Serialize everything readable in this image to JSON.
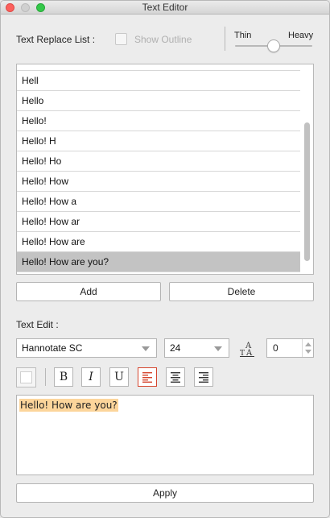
{
  "window": {
    "title": "Text Editor"
  },
  "replace": {
    "label": "Text Replace List :",
    "show_outline_label": "Show Outline",
    "show_outline_checked": false,
    "weight_min_label": "Thin",
    "weight_max_label": "Heavy",
    "items": [
      "Hell",
      "Hello",
      "Hello!",
      "Hello! H",
      "Hello! Ho",
      "Hello! How",
      "Hello! How a",
      "Hello! How ar",
      "Hello! How are",
      "Hello! How are you?"
    ],
    "selected_item": "Hello! How are you?",
    "add_label": "Add",
    "delete_label": "Delete"
  },
  "text_edit": {
    "label": "Text Edit :",
    "font": "Hannotate SC",
    "size": "24",
    "spacing": "0",
    "bold_label": "B",
    "italic_label": "I",
    "underline_label": "U",
    "alignment": "left",
    "content": "Hello! How are you?",
    "highlight_color": "#fcd59b",
    "active_color": "#d5452e"
  },
  "apply_label": "Apply"
}
